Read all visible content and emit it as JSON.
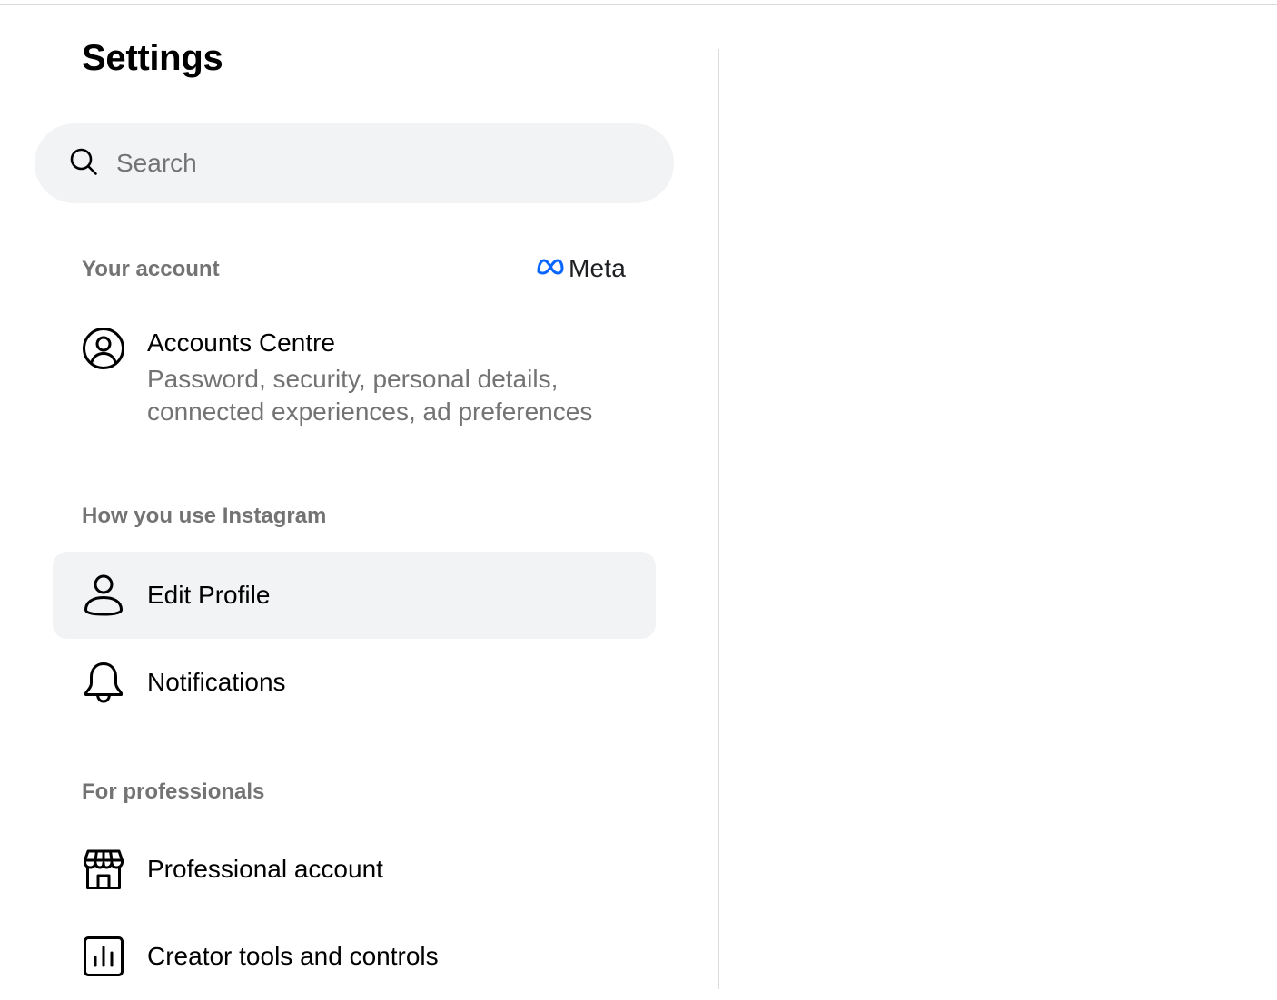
{
  "page": {
    "title": "Settings"
  },
  "search": {
    "placeholder": "Search",
    "icon": "search-icon"
  },
  "sections": {
    "your_account": {
      "label": "Your account",
      "brand": "Meta",
      "brand_color": "#0866ff"
    },
    "how_you_use": {
      "label": "How you use Instagram"
    },
    "for_professionals": {
      "label": "For professionals"
    }
  },
  "items": {
    "accounts_centre": {
      "title": "Accounts Centre",
      "description": "Password, security, personal details, connected experiences, ad preferences",
      "icon": "account-circle-icon"
    },
    "edit_profile": {
      "title": "Edit Profile",
      "icon": "person-icon",
      "active": true
    },
    "notifications": {
      "title": "Notifications",
      "icon": "bell-icon"
    },
    "professional_account": {
      "title": "Professional account",
      "icon": "shop-icon"
    },
    "creator_tools": {
      "title": "Creator tools and controls",
      "icon": "bar-chart-icon"
    }
  },
  "colors": {
    "muted_text": "#737373",
    "active_background": "#f2f3f5",
    "divider": "#dbdbdb"
  }
}
